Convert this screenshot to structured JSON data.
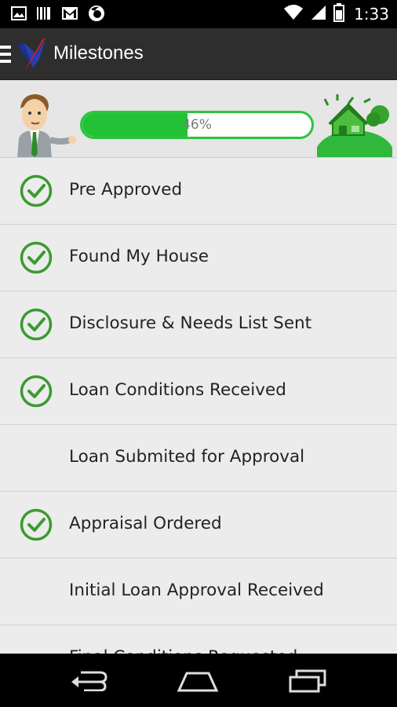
{
  "status_bar": {
    "time": "1:33",
    "icons": [
      "gallery-icon",
      "barcode-icon",
      "gmail-icon",
      "firefox-icon",
      "wifi-icon",
      "signal-icon",
      "battery-icon"
    ]
  },
  "action_bar": {
    "title": "Milestones",
    "icons": [
      "menu-icon",
      "app-logo-icon"
    ]
  },
  "progress": {
    "value": 0.46,
    "label": "46%",
    "colors": {
      "fill": "#22c236",
      "border": "#2bc441"
    }
  },
  "milestones": [
    {
      "label": "Pre Approved",
      "completed": true
    },
    {
      "label": "Found My House",
      "completed": true
    },
    {
      "label": "Disclosure & Needs List Sent",
      "completed": true
    },
    {
      "label": "Loan Conditions Received",
      "completed": true
    },
    {
      "label": "Loan Submited for Approval",
      "completed": false
    },
    {
      "label": "Appraisal Ordered",
      "completed": true
    },
    {
      "label": "Initial Loan Approval Received",
      "completed": false
    },
    {
      "label": "Final Conditions Requested",
      "completed": false
    }
  ],
  "nav_bar": {
    "icons": [
      "back-icon",
      "home-icon",
      "recent-apps-icon"
    ]
  },
  "colors": {
    "check": "#3a9b2f",
    "action_bar": "#2e2e2e",
    "list_background": "#ececec"
  }
}
